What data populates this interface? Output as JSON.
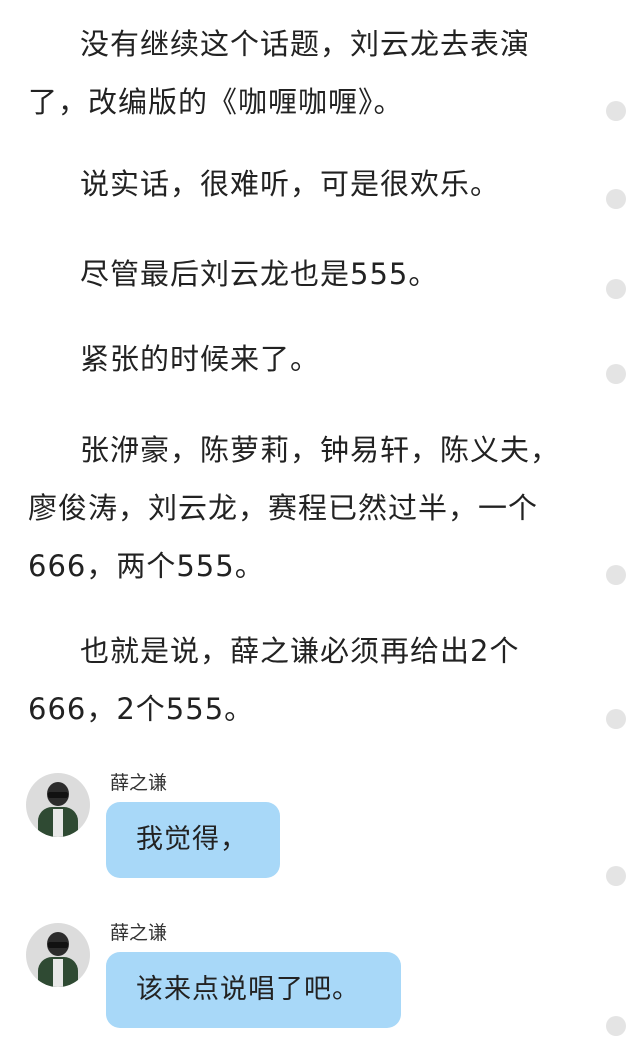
{
  "paragraphs": [
    "没有继续这个话题，刘云龙去表演了，改编版的《咖喱咖喱》。",
    "说实话，很难听，可是很欢乐。",
    "尽管最后刘云龙也是555。",
    "紧张的时候来了。",
    "张洢豪，陈萝莉，钟易轩，陈义夫，廖俊涛，刘云龙，赛程已然过半，一个666，两个555。",
    "也就是说，薛之谦必须再给出2个666，2个555。"
  ],
  "chat": [
    {
      "speaker": "薛之谦",
      "message": "我觉得，"
    },
    {
      "speaker": "薛之谦",
      "message": "该来点说唱了吧。"
    }
  ],
  "icons": {
    "avatar": "avatar-photo",
    "side_marker": "circle-icon"
  },
  "colors": {
    "bubble": "#a8d8f8",
    "side_dot": "#e4e4e4",
    "text": "#222222"
  }
}
